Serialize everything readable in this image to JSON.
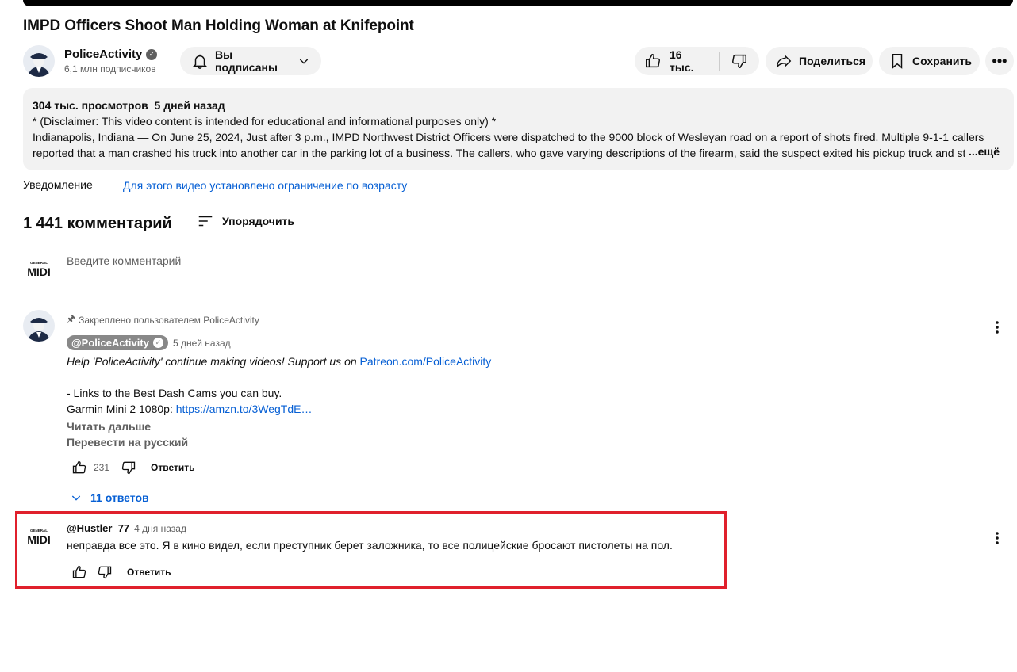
{
  "video": {
    "title": "IMPD Officers Shoot Man Holding Woman at Knifepoint"
  },
  "channel": {
    "name": "PoliceActivity",
    "subscribers": "6,1 млн подписчиков",
    "subscribe_label": "Вы подписаны"
  },
  "actions": {
    "likes": "16 тыс.",
    "share_label": "Поделиться",
    "save_label": "Сохранить"
  },
  "description": {
    "views": "304 тыс. просмотров",
    "date": "5 дней назад",
    "line1": "* (Disclaimer: This video content is intended for educational and informational purposes only) *",
    "line2": "Indianapolis, Indiana — On June 25, 2024, Just after 3 p.m., IMPD Northwest District Officers were dispatched to the 9000 block of Wesleyan road on a report of shots fired. Multiple 9-1-1 callers reported that a man crashed his truck into another car in the parking lot of a business. The callers, who gave varying descriptions of the firearm, said the suspect exited his pickup truck and st",
    "more_label": "...ещё"
  },
  "notice": {
    "label": "Уведомление",
    "link": "Для этого видео установлено ограничение по возрасту"
  },
  "comments": {
    "count_label": "1 441 комментарий",
    "sort_label": "Упорядочить",
    "input_placeholder": "Введите комментарий",
    "items": [
      {
        "pinned_label": "Закреплено пользователем PoliceActivity",
        "author": "@PoliceActivity",
        "time": "5 дней назад",
        "text_italic": "Help 'PoliceActivity' continue making videos! Support us on ",
        "link1": "Patreon.com/PoliceActivity",
        "line2": "- Links to the Best Dash Cams you can buy.",
        "line3_prefix": "Garmin Mini 2 1080p: ",
        "link2": "https://amzn.to/3WegTdE…",
        "read_more": "Читать дальше",
        "translate": "Перевести на русский",
        "likes": "231",
        "reply_label": "Ответить",
        "replies_label": "11 ответов"
      },
      {
        "author": "@Hustler_77",
        "time": "4 дня назад",
        "text": "неправда все это. Я в кино видел, если преступник берет заложника, то все полицейские бросают пистолеты на пол.",
        "reply_label": "Ответить"
      }
    ]
  },
  "avatar_logo_text": {
    "top": "GENERAL",
    "bottom": "MIDI"
  },
  "colors": {
    "highlight": "#e0202c",
    "link": "#065fd4",
    "pill_bg": "#f2f2f2"
  }
}
